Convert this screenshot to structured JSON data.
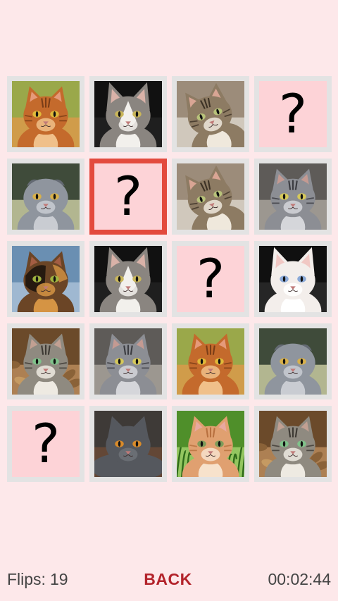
{
  "board": {
    "hidden_symbol": "?",
    "cards": [
      {
        "state": "revealed",
        "cat": "ginger-tabby-cat"
      },
      {
        "state": "revealed",
        "cat": "grey-white-sphynx-cat"
      },
      {
        "state": "revealed",
        "cat": "brown-tabby-lying-cat"
      },
      {
        "state": "hidden"
      },
      {
        "state": "revealed",
        "cat": "grey-scottish-fold-cat"
      },
      {
        "state": "hidden",
        "selected": true
      },
      {
        "state": "revealed",
        "cat": "brown-tabby-lying-cat"
      },
      {
        "state": "revealed",
        "cat": "silver-tabby-cat"
      },
      {
        "state": "revealed",
        "cat": "tortoiseshell-cat"
      },
      {
        "state": "revealed",
        "cat": "grey-white-sphynx-cat"
      },
      {
        "state": "hidden"
      },
      {
        "state": "revealed",
        "cat": "white-siamese-cat"
      },
      {
        "state": "revealed",
        "cat": "tabby-kitten-in-leaves"
      },
      {
        "state": "revealed",
        "cat": "silver-tabby-cat"
      },
      {
        "state": "revealed",
        "cat": "ginger-tabby-cat"
      },
      {
        "state": "revealed",
        "cat": "grey-scottish-fold-cat"
      },
      {
        "state": "hidden"
      },
      {
        "state": "revealed",
        "cat": "grey-british-shorthair-cat"
      },
      {
        "state": "revealed",
        "cat": "ginger-kitten-in-grass"
      },
      {
        "state": "revealed",
        "cat": "tabby-kitten-in-leaves"
      }
    ]
  },
  "footer": {
    "flips_label": "Flips:",
    "flips_count": "19",
    "back_label": "BACK",
    "timer": "00:02:44"
  },
  "colors": {
    "background": "#fde8ea",
    "card_border": "#e3e3e3",
    "card_selected_border": "#e34a3d",
    "hidden_face": "#fdd3d7",
    "back_text": "#b3232b"
  }
}
